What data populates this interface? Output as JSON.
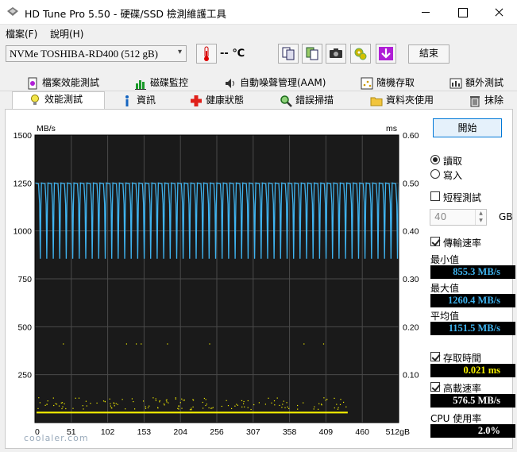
{
  "window": {
    "title": "HD Tune Pro 5.50 - 硬碟/SSD 檢測維護工具"
  },
  "menu": {
    "file": "檔案(F)",
    "help": "說明(H)"
  },
  "toolbar": {
    "drive": "NVMe    TOSHIBA-RD400 (512 gB)",
    "temperature": "-- ℃",
    "exit_label": "結束"
  },
  "tabs": {
    "row1": [
      "檔案效能測試",
      "磁碟監控",
      "自動噪聲管理(AAM)",
      "隨機存取",
      "額外測試"
    ],
    "row2": [
      "效能測試",
      "資訊",
      "健康狀態",
      "錯誤掃描",
      "資料夾使用",
      "抹除"
    ],
    "active": "效能測試"
  },
  "panel": {
    "start_label": "開始",
    "read_label": "讀取",
    "write_label": "寫入",
    "mode": "read",
    "short_test_label": "短程測試",
    "short_test_checked": false,
    "short_test_size": "40",
    "short_test_unit": "GB",
    "transfer_rate_label": "傳輸速率",
    "transfer_rate_checked": true,
    "min_label": "最小值",
    "min_value": "855.3 MB/s",
    "max_label": "最大值",
    "max_value": "1260.4 MB/s",
    "avg_label": "平均值",
    "avg_value": "1151.5 MB/s",
    "access_time_label": "存取時間",
    "access_time_checked": true,
    "access_time_value": "0.021 ms",
    "burst_rate_label": "高載速率",
    "burst_rate_checked": true,
    "burst_rate_value": "576.5 MB/s",
    "cpu_label": "CPU 使用率",
    "cpu_value": "2.0%"
  },
  "watermark": "coolaler.com",
  "chart_data": {
    "type": "line",
    "left_unit": "MB/s",
    "right_unit": "ms",
    "left_ticks": [
      "1500",
      "1250",
      "1000",
      "750",
      "500",
      "250"
    ],
    "right_ticks": [
      "0.60",
      "0.50",
      "0.40",
      "0.30",
      "0.20",
      "0.10"
    ],
    "x_ticks": [
      "0",
      "51",
      "102",
      "153",
      "204",
      "256",
      "307",
      "358",
      "409",
      "460",
      "512gB"
    ],
    "xlim": [
      0,
      512
    ],
    "ylim_left": [
      0,
      1500
    ],
    "ylim_right": [
      0,
      0.6
    ],
    "grid": true,
    "series": [
      {
        "color": "#3fb4f0",
        "axis": "left",
        "pattern": {
          "high": 1250,
          "low": 855,
          "cycles": 56
        }
      },
      {
        "color": "#f5f000",
        "axis": "right",
        "pattern": {
          "baseline": 0.021,
          "scatter_max": 0.165
        }
      }
    ],
    "colors": {
      "background": "#1a1a1a",
      "grid": "#4a4a4a"
    }
  }
}
